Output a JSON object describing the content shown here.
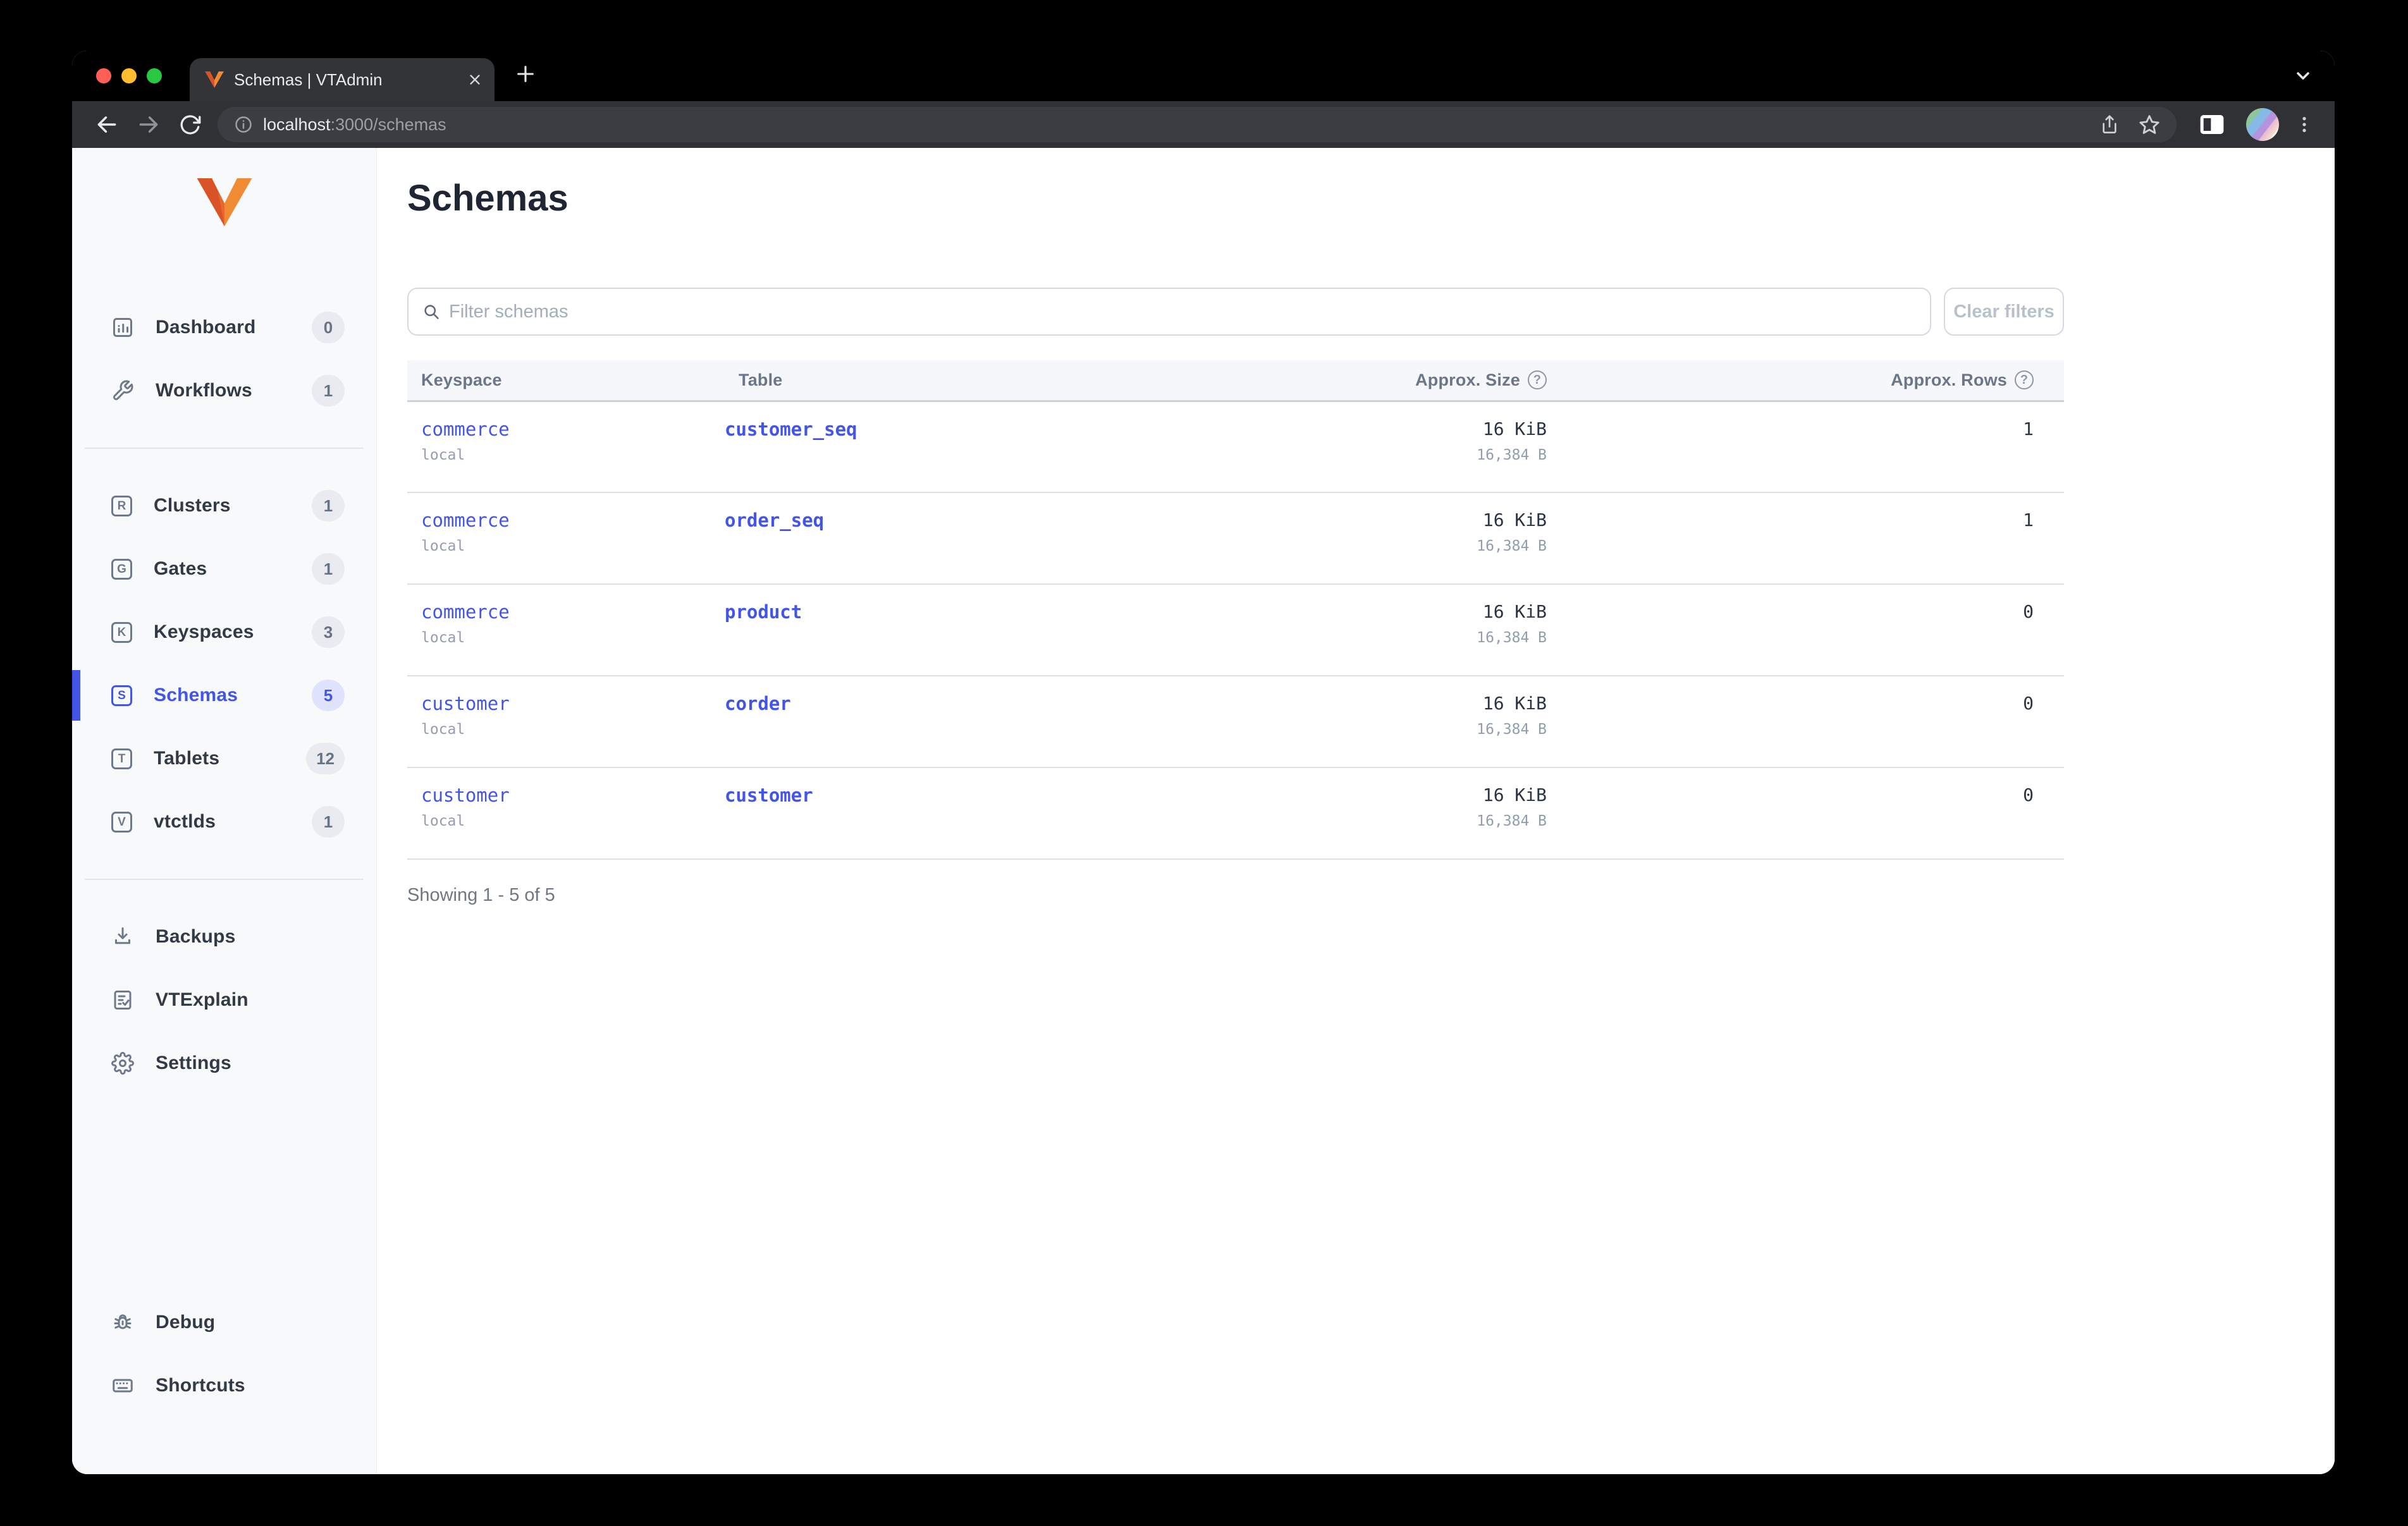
{
  "browser": {
    "tab": {
      "title": "Schemas | VTAdmin"
    },
    "url": {
      "host": "localhost",
      "path": ":3000/schemas"
    }
  },
  "sidebar": {
    "items": [
      {
        "label": "Dashboard",
        "badge": "0"
      },
      {
        "label": "Workflows",
        "badge": "1"
      },
      {
        "label": "Clusters",
        "badge": "1",
        "glyph": "R"
      },
      {
        "label": "Gates",
        "badge": "1",
        "glyph": "G"
      },
      {
        "label": "Keyspaces",
        "badge": "3",
        "glyph": "K"
      },
      {
        "label": "Schemas",
        "badge": "5",
        "glyph": "S",
        "active": true
      },
      {
        "label": "Tablets",
        "badge": "12",
        "glyph": "T"
      },
      {
        "label": "vtctlds",
        "badge": "1",
        "glyph": "V"
      },
      {
        "label": "Backups"
      },
      {
        "label": "VTExplain"
      },
      {
        "label": "Settings"
      },
      {
        "label": "Debug"
      },
      {
        "label": "Shortcuts"
      }
    ]
  },
  "main": {
    "title": "Schemas",
    "filter_placeholder": "Filter schemas",
    "clear_filters_label": "Clear filters",
    "table": {
      "columns": {
        "keyspace": "Keyspace",
        "table": "Table",
        "size": "Approx. Size",
        "rows": "Approx. Rows"
      },
      "help_glyph": "?",
      "rows": [
        {
          "keyspace": "commerce",
          "cluster": "local",
          "table": "customer_seq",
          "size": "16 KiB",
          "size_bytes": "16,384 B",
          "row_count": "1"
        },
        {
          "keyspace": "commerce",
          "cluster": "local",
          "table": "order_seq",
          "size": "16 KiB",
          "size_bytes": "16,384 B",
          "row_count": "1"
        },
        {
          "keyspace": "commerce",
          "cluster": "local",
          "table": "product",
          "size": "16 KiB",
          "size_bytes": "16,384 B",
          "row_count": "0"
        },
        {
          "keyspace": "customer",
          "cluster": "local",
          "table": "corder",
          "size": "16 KiB",
          "size_bytes": "16,384 B",
          "row_count": "0"
        },
        {
          "keyspace": "customer",
          "cluster": "local",
          "table": "customer",
          "size": "16 KiB",
          "size_bytes": "16,384 B",
          "row_count": "0"
        }
      ]
    },
    "footer": "Showing 1 - 5 of 5"
  },
  "colors": {
    "accent": "#4355e6",
    "link": "#4355e6",
    "sidebar_bg": "#f8f9fb",
    "badge_bg": "#e9ebf0",
    "active_badge_bg": "#dfe4fc",
    "table_header_bg": "#f6f7fa",
    "logo_orange_dark": "#da5227",
    "logo_orange_light": "#f08b33"
  }
}
